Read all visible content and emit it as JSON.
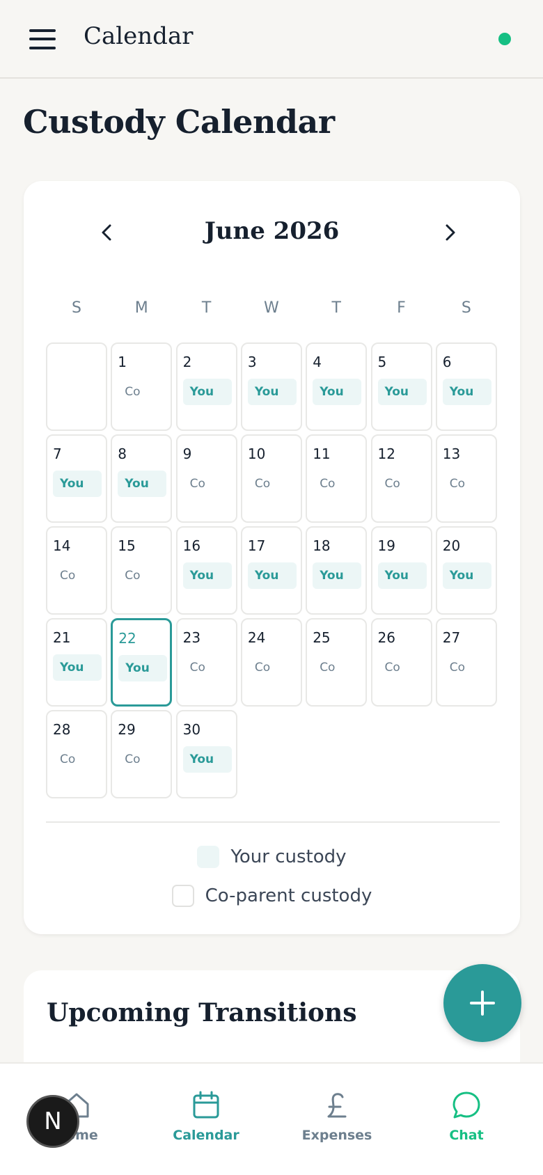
{
  "header": {
    "title": "Calendar",
    "status_color": "#16bf83"
  },
  "page": {
    "title": "Custody Calendar"
  },
  "calendar": {
    "month_label": "June 2026",
    "weekdays": [
      "S",
      "M",
      "T",
      "W",
      "T",
      "F",
      "S"
    ],
    "today": 22,
    "days": [
      {
        "day": "1",
        "tag": "Co"
      },
      {
        "day": "2",
        "tag": "You"
      },
      {
        "day": "3",
        "tag": "You"
      },
      {
        "day": "4",
        "tag": "You"
      },
      {
        "day": "5",
        "tag": "You"
      },
      {
        "day": "6",
        "tag": "You"
      },
      {
        "day": "7",
        "tag": "You"
      },
      {
        "day": "8",
        "tag": "You"
      },
      {
        "day": "9",
        "tag": "Co"
      },
      {
        "day": "10",
        "tag": "Co"
      },
      {
        "day": "11",
        "tag": "Co"
      },
      {
        "day": "12",
        "tag": "Co"
      },
      {
        "day": "13",
        "tag": "Co"
      },
      {
        "day": "14",
        "tag": "Co"
      },
      {
        "day": "15",
        "tag": "Co"
      },
      {
        "day": "16",
        "tag": "You"
      },
      {
        "day": "17",
        "tag": "You"
      },
      {
        "day": "18",
        "tag": "You"
      },
      {
        "day": "19",
        "tag": "You"
      },
      {
        "day": "20",
        "tag": "You"
      },
      {
        "day": "21",
        "tag": "You"
      },
      {
        "day": "22",
        "tag": "You"
      },
      {
        "day": "23",
        "tag": "Co"
      },
      {
        "day": "24",
        "tag": "Co"
      },
      {
        "day": "25",
        "tag": "Co"
      },
      {
        "day": "26",
        "tag": "Co"
      },
      {
        "day": "27",
        "tag": "Co"
      },
      {
        "day": "28",
        "tag": "Co"
      },
      {
        "day": "29",
        "tag": "Co"
      },
      {
        "day": "30",
        "tag": "You"
      }
    ],
    "legend": {
      "you": "Your custody",
      "co": "Co-parent custody"
    }
  },
  "upcoming": {
    "title": "Upcoming Transitions"
  },
  "bottom_nav": {
    "home": "Home",
    "calendar": "Calendar",
    "expenses": "Expenses",
    "chat": "Chat"
  },
  "badge": {
    "letter": "N"
  },
  "colors": {
    "accent": "#2a9a98",
    "you_bg": "#ecf6f6",
    "chat": "#16bf83"
  }
}
